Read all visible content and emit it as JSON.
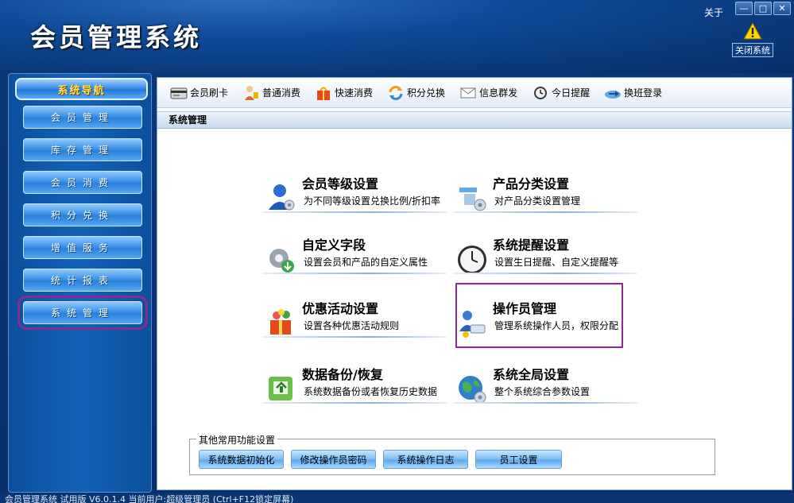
{
  "header": {
    "title": "会员管理系统",
    "about": "关于",
    "close_system": "关闭系统",
    "window_buttons": [
      "—",
      "□",
      "✕"
    ]
  },
  "sidebar": {
    "heading": "系统导航",
    "items": [
      {
        "label": "会员管理",
        "active": false
      },
      {
        "label": "库存管理",
        "active": false
      },
      {
        "label": "会员消费",
        "active": false
      },
      {
        "label": "积分兑换",
        "active": false
      },
      {
        "label": "增值服务",
        "active": false
      },
      {
        "label": "统计报表",
        "active": false
      },
      {
        "label": "系统管理",
        "active": true
      }
    ]
  },
  "toolbar": {
    "items": [
      {
        "label": "会员刷卡",
        "icon": "card-reader-icon"
      },
      {
        "label": "普通消费",
        "icon": "shopper-icon"
      },
      {
        "label": "快速消费",
        "icon": "gift-bag-icon"
      },
      {
        "label": "积分兑换",
        "icon": "exchange-arrows-icon"
      },
      {
        "label": "信息群发",
        "icon": "envelope-icon"
      },
      {
        "label": "今日提醒",
        "icon": "clock-icon"
      },
      {
        "label": "换班登录",
        "icon": "shift-login-icon"
      }
    ]
  },
  "section_title": "系统管理",
  "cards": [
    {
      "title": "会员等级设置",
      "desc": "为不同等级设置兑换比例/折扣率",
      "icon": "member-level-icon"
    },
    {
      "title": "产品分类设置",
      "desc": "对产品分类设置管理",
      "icon": "product-category-icon"
    },
    {
      "title": "自定义字段",
      "desc": "设置会员和产品的自定义属性",
      "icon": "custom-field-gear-icon"
    },
    {
      "title": "系统提醒设置",
      "desc": "设置生日提醒、自定义提醒等",
      "icon": "clock-icon"
    },
    {
      "title": "优惠活动设置",
      "desc": "设置各种优惠活动规则",
      "icon": "gift-box-icon"
    },
    {
      "title": "操作员管理",
      "desc": "管理系统操作人员，权限分配",
      "icon": "operator-icon"
    },
    {
      "title": "数据备份/恢复",
      "desc": "系统数据备份或者恢复历史数据",
      "icon": "backup-icon"
    },
    {
      "title": "系统全局设置",
      "desc": "整个系统综合参数设置",
      "icon": "globe-icon"
    }
  ],
  "other_settings": {
    "legend": "其他常用功能设置",
    "buttons": [
      "系统数据初始化",
      "修改操作员密码",
      "系统操作日志",
      "员工设置"
    ]
  },
  "status": "会员管理系统 试用版 V6.0.1.4 当前用户:超级管理员 (Ctrl+F12锁定屏幕)",
  "colors": {
    "highlight": "#8a2b8e",
    "nav_heading_text": "#ffe25a",
    "header_bg": "#0a3a7c"
  }
}
